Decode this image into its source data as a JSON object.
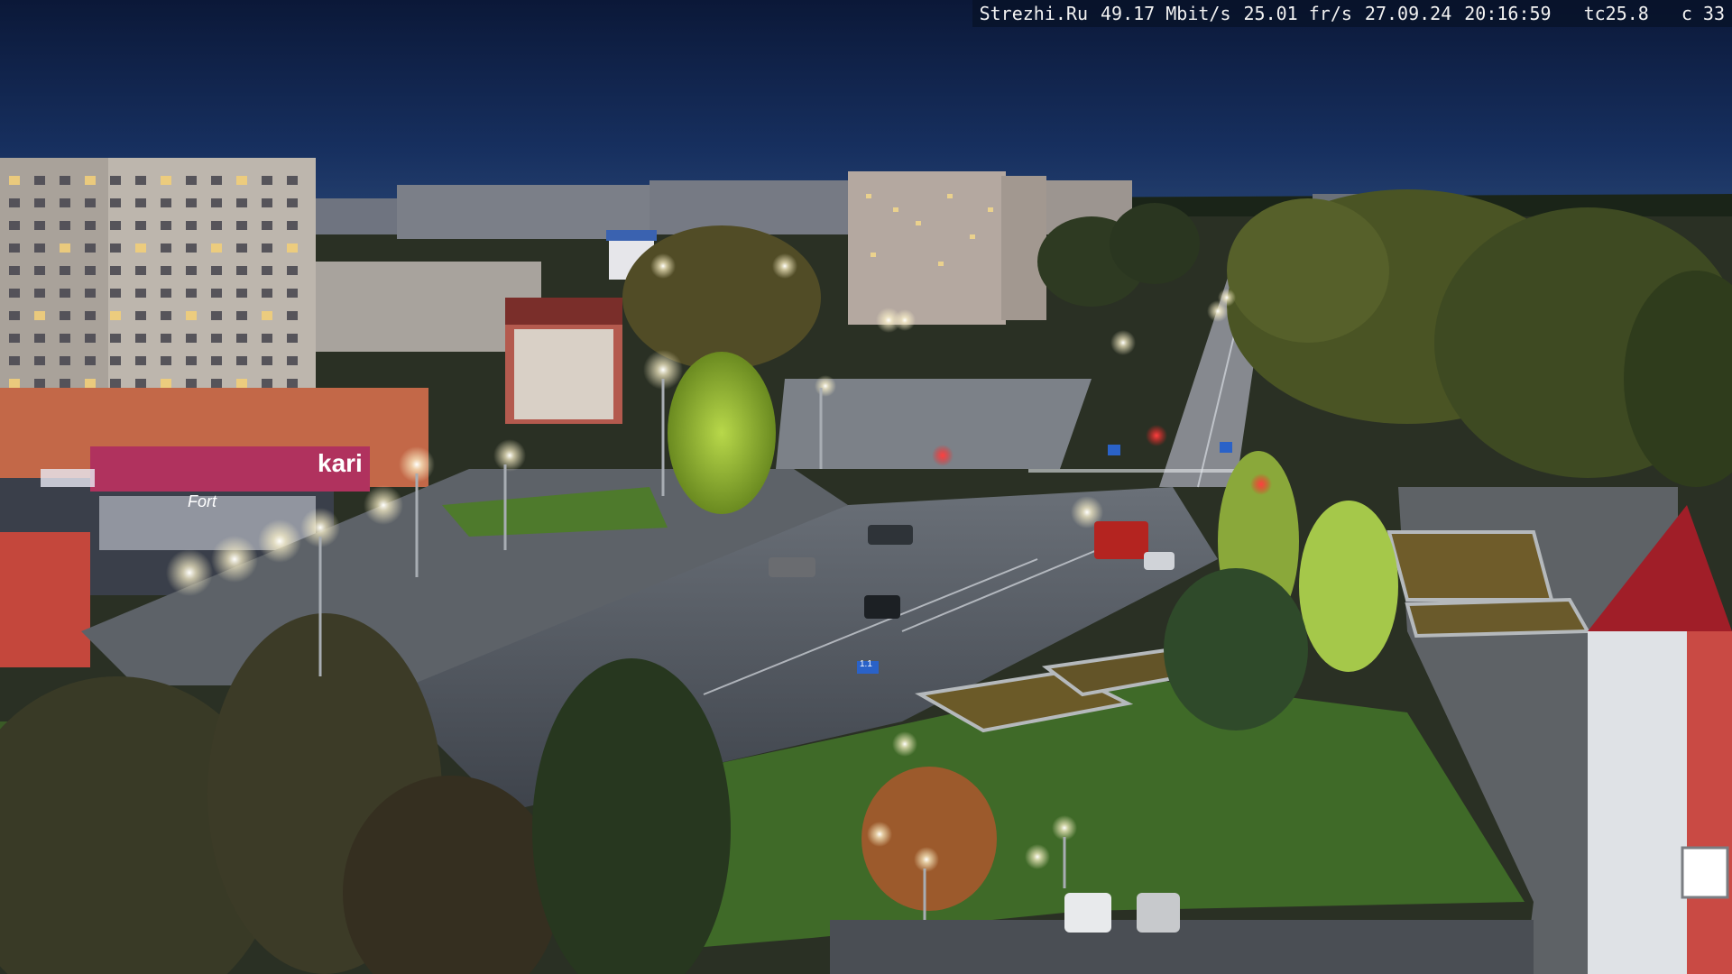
{
  "overlay": {
    "source": "Strezhi.Ru",
    "bitrate": "49.17 Mbit/s",
    "framerate": "25.01 fr/s",
    "date": "27.09.24",
    "time": "20:16:59",
    "temp_code": "tc25.8",
    "counter": "c 33"
  },
  "signage": {
    "store_sign": "kari",
    "store_sign_2": "Fort",
    "road_sign": "1.1"
  },
  "colors": {
    "sky_top": "#0b1838",
    "sky_horizon": "#1f3968",
    "road": "#4a4f58",
    "grass": "#3b5a2a",
    "lamp": "#fff7d8",
    "brick": "#b5483a",
    "overlay_bg": "#08122a"
  }
}
